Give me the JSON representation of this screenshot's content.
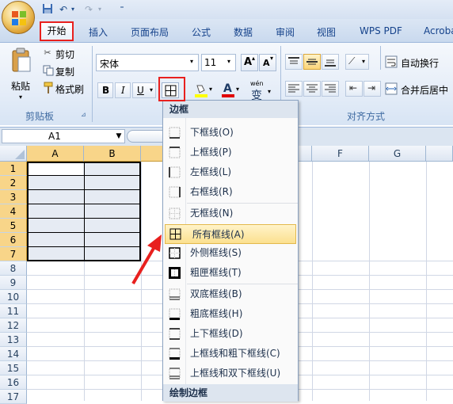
{
  "ribbon_tabs": [
    "开始",
    "插入",
    "页面布局",
    "公式",
    "数据",
    "审阅",
    "视图",
    "WPS PDF",
    "Acroba"
  ],
  "clipboard": {
    "paste": "粘贴",
    "cut": "剪切",
    "copy": "复制",
    "format_painter": "格式刷",
    "group_label": "剪贴板"
  },
  "font": {
    "name": "宋体",
    "size": "11",
    "bold": "B",
    "italic": "I",
    "underline": "U",
    "grow": "A",
    "shrink": "A",
    "color_letter": "A",
    "phonetic": "wén",
    "phonetic_char": "变"
  },
  "alignment": {
    "wrap_text": "自动换行",
    "merge_center": "合并后居中",
    "group_label": "对齐方式"
  },
  "formula_bar": {
    "name_box": "A1"
  },
  "sheet": {
    "columns": [
      "A",
      "B",
      "",
      "",
      "",
      "F",
      "G",
      ""
    ],
    "rows": [
      "1",
      "2",
      "3",
      "4",
      "5",
      "6",
      "7",
      "8",
      "9",
      "10",
      "11",
      "12",
      "13",
      "14",
      "15",
      "16",
      "17"
    ]
  },
  "border_menu": {
    "title": "边框",
    "items": [
      {
        "label": "下框线(O)",
        "icon": "bottom-border-icon"
      },
      {
        "label": "上框线(P)",
        "icon": "top-border-icon"
      },
      {
        "label": "左框线(L)",
        "icon": "left-border-icon"
      },
      {
        "label": "右框线(R)",
        "icon": "right-border-icon"
      },
      {
        "label": "无框线(N)",
        "icon": "no-border-icon"
      },
      {
        "label": "所有框线(A)",
        "icon": "all-borders-icon"
      },
      {
        "label": "外侧框线(S)",
        "icon": "outside-borders-icon"
      },
      {
        "label": "粗匣框线(T)",
        "icon": "thick-box-border-icon"
      },
      {
        "label": "双底框线(B)",
        "icon": "bottom-double-border-icon"
      },
      {
        "label": "粗底框线(H)",
        "icon": "thick-bottom-border-icon"
      },
      {
        "label": "上下框线(D)",
        "icon": "top-bottom-border-icon"
      },
      {
        "label": "上框线和粗下框线(C)",
        "icon": "top-thick-bottom-border-icon"
      },
      {
        "label": "上框线和双下框线(U)",
        "icon": "top-double-bottom-border-icon"
      }
    ],
    "footer_title": "绘制边框"
  },
  "colors": {
    "accent_red": "#e8201e",
    "highlight": "#fbe08f",
    "selection": "#e6ebf3"
  }
}
